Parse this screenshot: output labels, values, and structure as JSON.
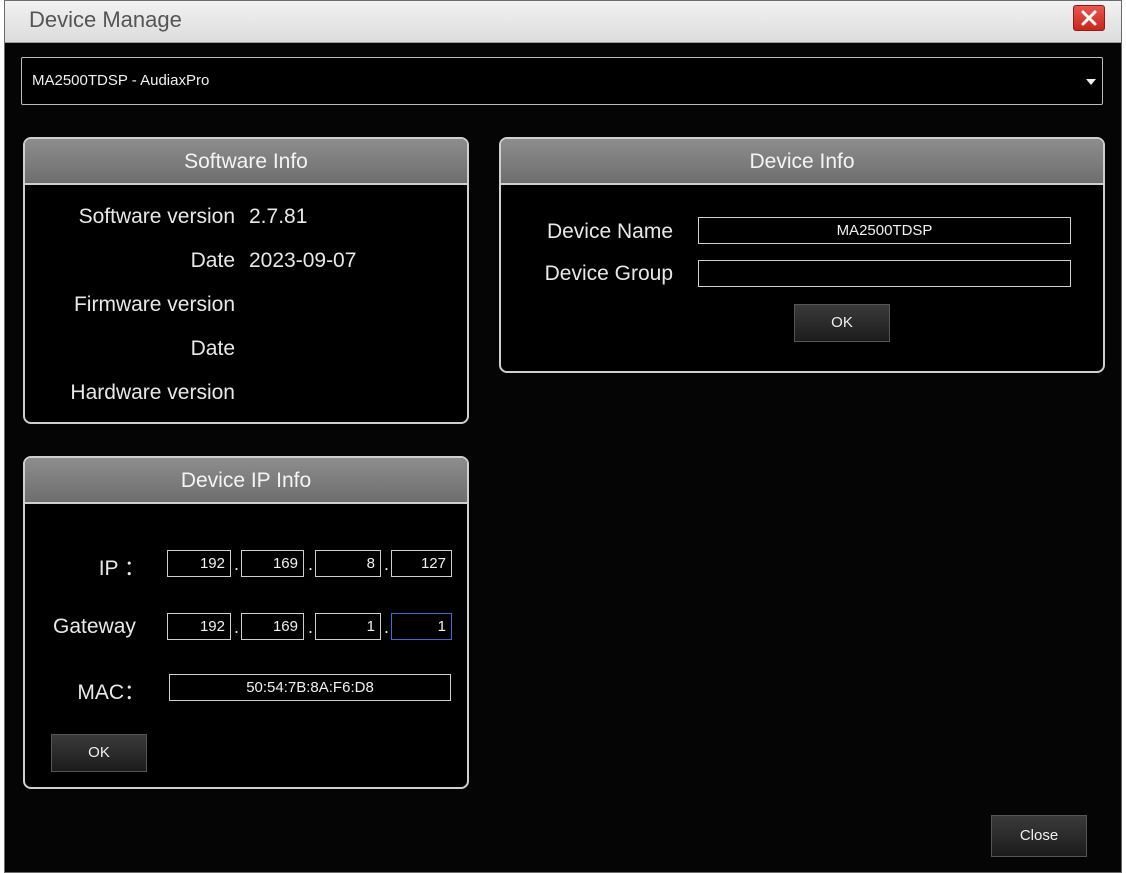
{
  "window": {
    "title": "Device Manage"
  },
  "device_select": {
    "value": "MA2500TDSP - AudiaxPro"
  },
  "software_info": {
    "header": "Software Info",
    "software_version_label": "Software version",
    "software_version_value": "2.7.81",
    "software_date_label": "Date",
    "software_date_value": "2023-09-07",
    "firmware_version_label": "Firmware version",
    "firmware_date_label": "Date",
    "hardware_version_label": "Hardware version"
  },
  "device_ip_info": {
    "header": "Device IP Info",
    "ip_label": "IP ：",
    "ip": [
      "192",
      "169",
      "8",
      "127"
    ],
    "gateway_label": "Gateway",
    "gateway": [
      "192",
      "169",
      "1",
      "1"
    ],
    "mac_label": "MAC：",
    "mac": "50:54:7B:8A:F6:D8",
    "ok_label": "OK",
    "dot": "."
  },
  "device_info": {
    "header": "Device Info",
    "name_label": "Device Name",
    "name_value": "MA2500TDSP",
    "group_label": "Device Group",
    "group_value": "",
    "ok_label": "OK"
  },
  "footer": {
    "close_label": "Close"
  }
}
